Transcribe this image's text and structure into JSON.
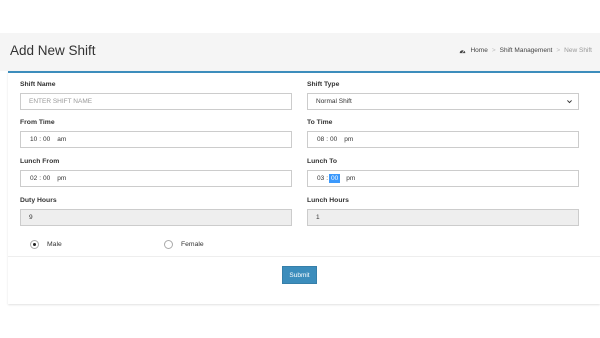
{
  "header": {
    "title": "Add New Shift",
    "breadcrumb": [
      {
        "label": "Home",
        "icon": "dashboard-icon"
      },
      {
        "label": "Shift Management"
      },
      {
        "label": "New Shift"
      }
    ]
  },
  "form": {
    "shift_name": {
      "label": "Shift Name",
      "value": "",
      "placeholder": "ENTER SHIFT NAME"
    },
    "shift_type": {
      "label": "Shift Type",
      "value": "Normal Shift"
    },
    "from_time": {
      "label": "From Time",
      "hour": "10",
      "minute": "00",
      "ampm": "am"
    },
    "to_time": {
      "label": "To Time",
      "hour": "08",
      "minute": "00",
      "ampm": "pm"
    },
    "lunch_from": {
      "label": "Lunch From",
      "hour": "02",
      "minute": "00",
      "ampm": "pm"
    },
    "lunch_to": {
      "label": "Lunch To",
      "hour": "03",
      "minute": "00",
      "ampm": "pm"
    },
    "duty_hours": {
      "label": "Duty Hours",
      "value": "9"
    },
    "lunch_hours": {
      "label": "Lunch Hours",
      "value": "1"
    },
    "gender_options": [
      {
        "label": "Male",
        "checked": true
      },
      {
        "label": "Female",
        "checked": false
      }
    ],
    "submit_label": "Submit"
  },
  "colors": {
    "accent": "#3c8dbc",
    "highlight": "#3b99fc"
  }
}
